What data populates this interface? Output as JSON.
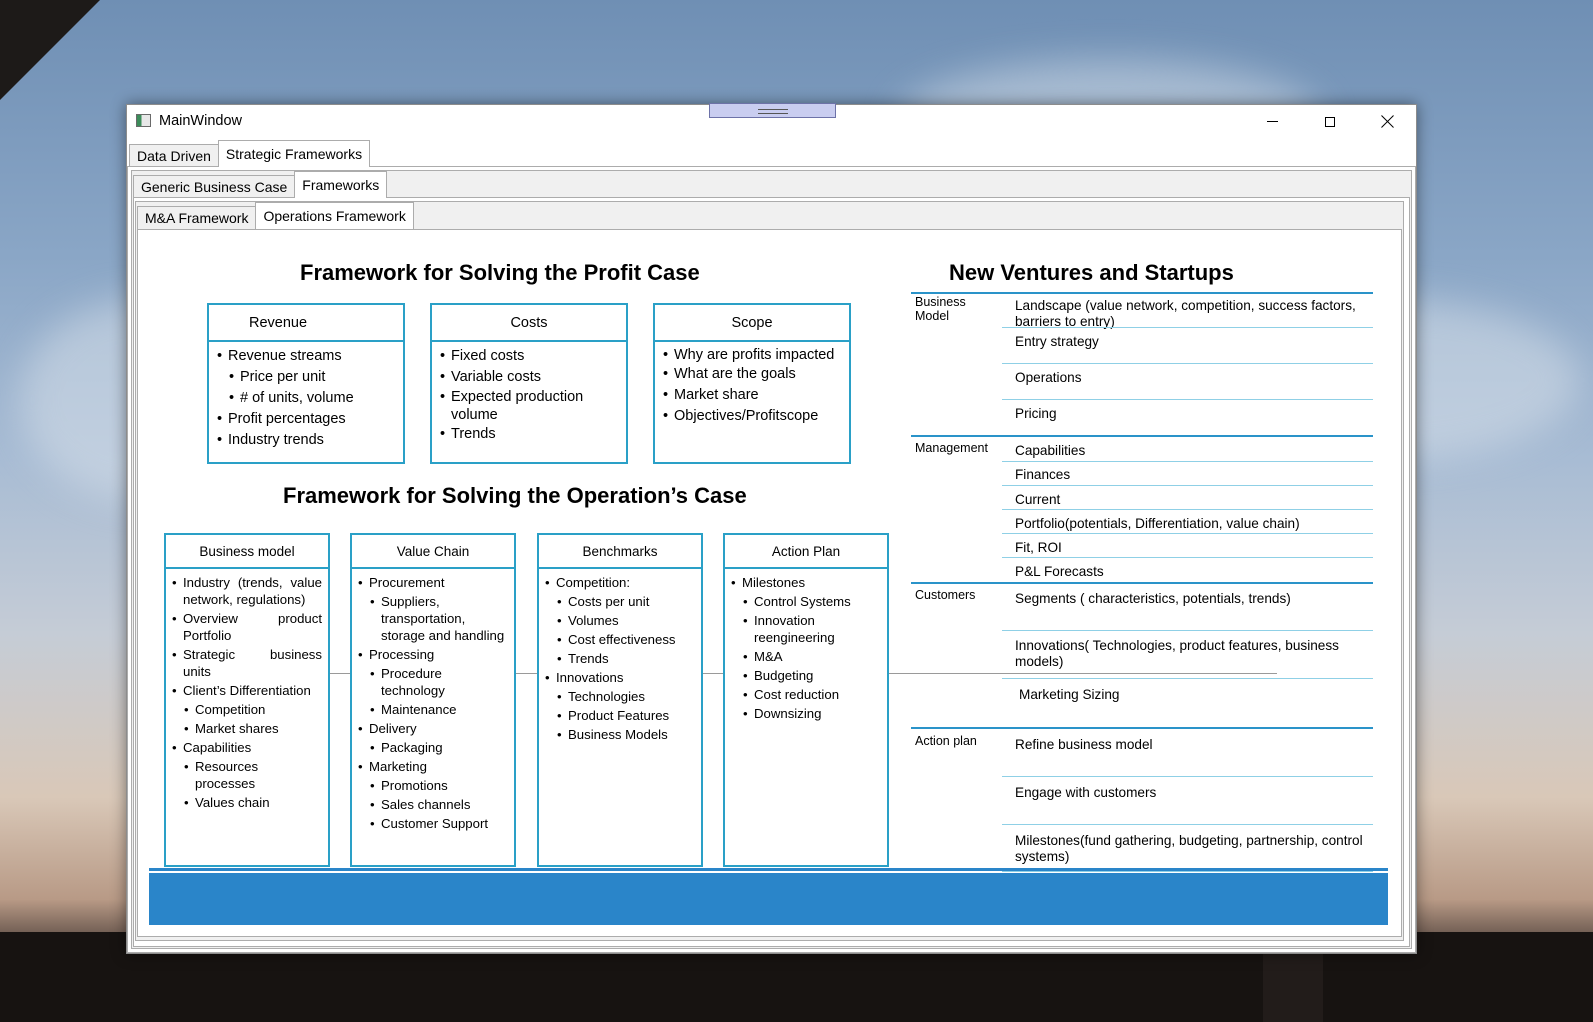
{
  "window": {
    "title": "MainWindow"
  },
  "tabs": {
    "level1": [
      "Data Driven",
      "Strategic Frameworks"
    ],
    "level2": [
      "Generic Business Case",
      "Frameworks"
    ],
    "level3": [
      "M&A Framework",
      "Operations Framework"
    ]
  },
  "slide": {
    "profit_title": "Framework for Solving the Profit Case",
    "operations_title": "Framework for Solving the Operation’s Case",
    "ventures_title": "New Ventures and Startups",
    "profit_boxes": [
      {
        "title": "Revenue",
        "items": [
          "Revenue streams",
          "Price per unit",
          "# of units, volume",
          "Profit percentages",
          "Industry trends"
        ]
      },
      {
        "title": "Costs",
        "items": [
          "Fixed costs",
          "Variable costs",
          "Expected production volume",
          "Trends"
        ]
      },
      {
        "title": "Scope",
        "items": [
          "Why are profits impacted",
          "What are the goals",
          "Market share",
          "Objectives/Profitscope"
        ]
      }
    ],
    "operations_boxes": [
      {
        "title": "Business model",
        "items": [
          "Industry (trends, value network, regulations)",
          "Overview product Portfolio",
          "Strategic business units",
          "Client’s Differentiation",
          "Competition",
          "Market shares",
          "Capabilities",
          "Resources processes",
          "Values chain"
        ]
      },
      {
        "title": "Value Chain",
        "items": [
          "Procurement",
          "Suppliers, transportation, storage and handling",
          "Processing",
          "Procedure technology",
          "Maintenance",
          "Delivery",
          "Packaging",
          "Marketing",
          "Promotions",
          "Sales channels",
          "Customer Support"
        ]
      },
      {
        "title": "Benchmarks",
        "items": [
          "Competition:",
          "Costs per unit",
          "Volumes",
          "Cost effectiveness",
          "Trends",
          "Innovations",
          "Technologies",
          "Product Features",
          "Business Models"
        ]
      },
      {
        "title": "Action Plan",
        "items": [
          "Milestones",
          "Control Systems",
          "Innovation reengineering",
          "M&A",
          "Budgeting",
          "Cost reduction",
          "Downsizing"
        ]
      }
    ],
    "ventures": {
      "groups": [
        {
          "label": "Business Model",
          "items": [
            "Landscape (value network, competition, success factors, barriers to entry)",
            "Entry strategy",
            "Operations",
            "Pricing"
          ]
        },
        {
          "label": "Management",
          "items": [
            "Capabilities",
            "Finances",
            "Current",
            "Portfolio(potentials, Differentiation, value chain)",
            "Fit, ROI",
            "P&L Forecasts"
          ]
        },
        {
          "label": "Customers",
          "items": [
            "Segments ( characteristics, potentials, trends)",
            "Innovations( Technologies, product features, business models)",
            "Marketing Sizing"
          ]
        },
        {
          "label": "Action plan",
          "items": [
            "Refine business model",
            "Engage with customers",
            "Milestones(fund gathering, budgeting, partnership, control systems)"
          ]
        }
      ]
    }
  },
  "colors": {
    "accent": "#2aa0c7",
    "footer": "#2a85c9"
  }
}
